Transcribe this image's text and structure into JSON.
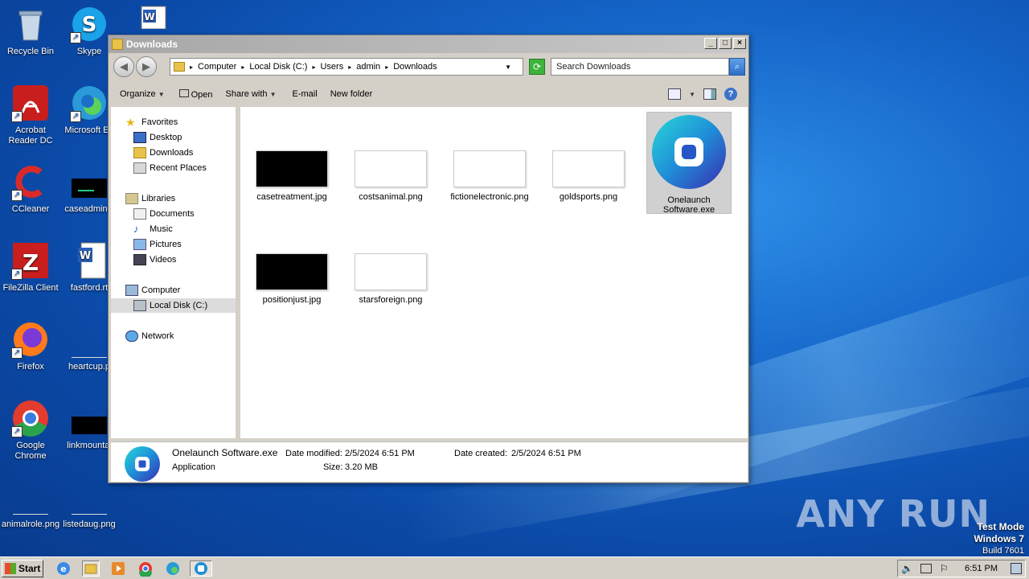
{
  "desktop": {
    "icons": [
      {
        "label": "Recycle Bin"
      },
      {
        "label": "Skype"
      },
      {
        "label": "Acrobat Reader DC"
      },
      {
        "label": "Microsoft Ed"
      },
      {
        "label": "CCleaner"
      },
      {
        "label": "caseadminis"
      },
      {
        "label": "FileZilla Client"
      },
      {
        "label": "fastford.rt"
      },
      {
        "label": "Firefox"
      },
      {
        "label": "heartcup.p"
      },
      {
        "label": "Google Chrome"
      },
      {
        "label": "linkmountai"
      },
      {
        "label": "animalrole.png"
      },
      {
        "label": "listedaug.png"
      }
    ]
  },
  "window": {
    "title": "Downloads",
    "address": [
      "Computer",
      "Local Disk (C:)",
      "Users",
      "admin",
      "Downloads"
    ],
    "search_placeholder": "Search Downloads",
    "commands": {
      "organize": "Organize",
      "open": "Open",
      "share_with": "Share with",
      "email": "E-mail",
      "new_folder": "New folder"
    },
    "nav": {
      "favorites": "Favorites",
      "desktop": "Desktop",
      "downloads": "Downloads",
      "recent_places": "Recent Places",
      "libraries": "Libraries",
      "documents": "Documents",
      "music": "Music",
      "pictures": "Pictures",
      "videos": "Videos",
      "computer": "Computer",
      "local_disk": "Local Disk (C:)",
      "network": "Network"
    },
    "files": [
      {
        "name": "casetreatment.jpg"
      },
      {
        "name": "costsanimal.png"
      },
      {
        "name": "fictionelectronic.png"
      },
      {
        "name": "goldsports.png"
      },
      {
        "name": "Onelaunch Software.exe"
      },
      {
        "name": "positionjust.jpg"
      },
      {
        "name": "starsforeign.png"
      }
    ],
    "details": {
      "name": "Onelaunch Software.exe",
      "type": "Application",
      "date_modified_label": "Date modified:",
      "date_modified": "2/5/2024 6:51 PM",
      "size_label": "Size:",
      "size": "3.20 MB",
      "date_created_label": "Date created:",
      "date_created": "2/5/2024 6:51 PM"
    }
  },
  "taskbar": {
    "start": "Start",
    "clock": "6:51 PM"
  },
  "watermark": {
    "brand": "ANY RUN",
    "line1": "Test Mode",
    "line2": "Windows 7",
    "line3": "Build 7601"
  },
  "colors": {
    "accent_blue": "#1565c8",
    "onelaunch_teal": "#1fb7d8",
    "onelaunch_purple": "#3a2bb0"
  }
}
